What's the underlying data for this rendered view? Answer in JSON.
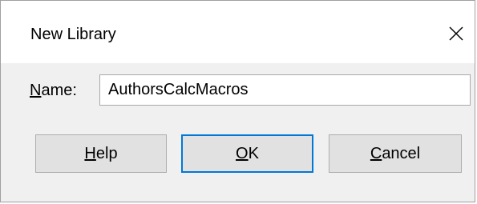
{
  "window": {
    "title": "New Library"
  },
  "form": {
    "name_label_mnemonic": "N",
    "name_label_rest": "ame:",
    "name_value": "AuthorsCalcMacros"
  },
  "buttons": {
    "help_mnemonic": "H",
    "help_rest": "elp",
    "ok_mnemonic": "O",
    "ok_rest": "K",
    "cancel_mnemonic": "C",
    "cancel_rest": "ancel"
  },
  "icons": {
    "close": "close-icon"
  },
  "colors": {
    "dialog_background": "#f0f0f0",
    "titlebar_background": "#ffffff",
    "button_background": "#e1e1e1",
    "button_border": "#adadad",
    "default_button_border": "#0078d7",
    "input_border": "#a9a9a9"
  }
}
